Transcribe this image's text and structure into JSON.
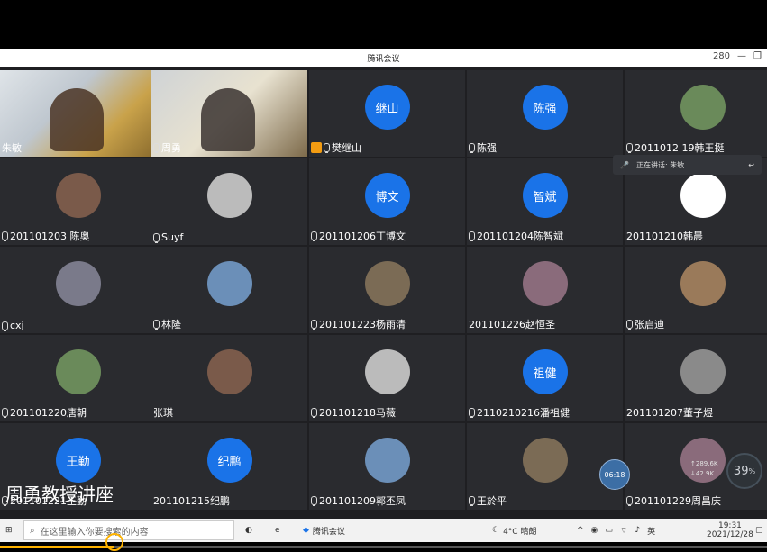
{
  "window": {
    "title": "腾讯会议",
    "status_suffix": "280"
  },
  "tiles": [
    {
      "name": "朱敏",
      "type": "video",
      "mic": false
    },
    {
      "name": "周勇",
      "type": "video",
      "mic": true
    },
    {
      "name": "樊继山",
      "type": "avatar",
      "avatar": "继山",
      "mic": true,
      "host": true
    },
    {
      "name": "陈强",
      "type": "avatar",
      "avatar": "陈强",
      "mic": true
    },
    {
      "name": "2011012 19韩王挺",
      "type": "image",
      "mic": true
    },
    {
      "name": "201101203 陈奥",
      "type": "image",
      "mic": true
    },
    {
      "name": "Suyf",
      "type": "image",
      "mic": true
    },
    {
      "name": "201101206丁博文",
      "type": "avatar",
      "avatar": "博文",
      "mic": true
    },
    {
      "name": "201101204陈智斌",
      "type": "avatar",
      "avatar": "智斌",
      "mic": true
    },
    {
      "name": "201101210韩晨",
      "type": "white",
      "mic": false
    },
    {
      "name": "cxj",
      "type": "image",
      "mic": true
    },
    {
      "name": "林隆",
      "type": "image",
      "mic": true
    },
    {
      "name": "201101223杨雨清",
      "type": "image",
      "mic": true
    },
    {
      "name": "201101226赵恒圣",
      "type": "image",
      "mic": false
    },
    {
      "name": "张启迪",
      "type": "image",
      "mic": true
    },
    {
      "name": "201101220唐朝",
      "type": "image",
      "mic": true
    },
    {
      "name": "张琪",
      "type": "image",
      "mic": false
    },
    {
      "name": "201101218马薇",
      "type": "image",
      "mic": true
    },
    {
      "name": "2110210216潘祖健",
      "type": "avatar",
      "avatar": "祖健",
      "mic": true
    },
    {
      "name": "201101207董子煜",
      "type": "image",
      "mic": false
    },
    {
      "name": "201101221王勤",
      "type": "avatar",
      "avatar": "王勤",
      "mic": true
    },
    {
      "name": "201101215纪鹏",
      "type": "avatar",
      "avatar": "纪鹏",
      "mic": false
    },
    {
      "name": "201101209郭丕凤",
      "type": "image",
      "mic": true
    },
    {
      "name": "王於平",
      "type": "image",
      "mic": true
    },
    {
      "name": "201101229周昌庆",
      "type": "image",
      "mic": true
    }
  ],
  "speaking": {
    "label": "正在讲话: 朱敏"
  },
  "overlay": {
    "title": "周勇教授讲座",
    "timer": "06:18",
    "net_percent": "39",
    "net_up": "↑289.6K",
    "net_down": "↓42.9K"
  },
  "taskbar": {
    "search_placeholder": "在这里输入你要搜索的内容",
    "app_label": "腾讯会议",
    "weather": "4°C 晴朗",
    "ime": "英",
    "time": "19:31",
    "date": "2021/12/28"
  },
  "playback": {
    "progress": 0.149
  },
  "colors": {
    "accent": "#1a73e8",
    "progress": "#ffb300"
  }
}
